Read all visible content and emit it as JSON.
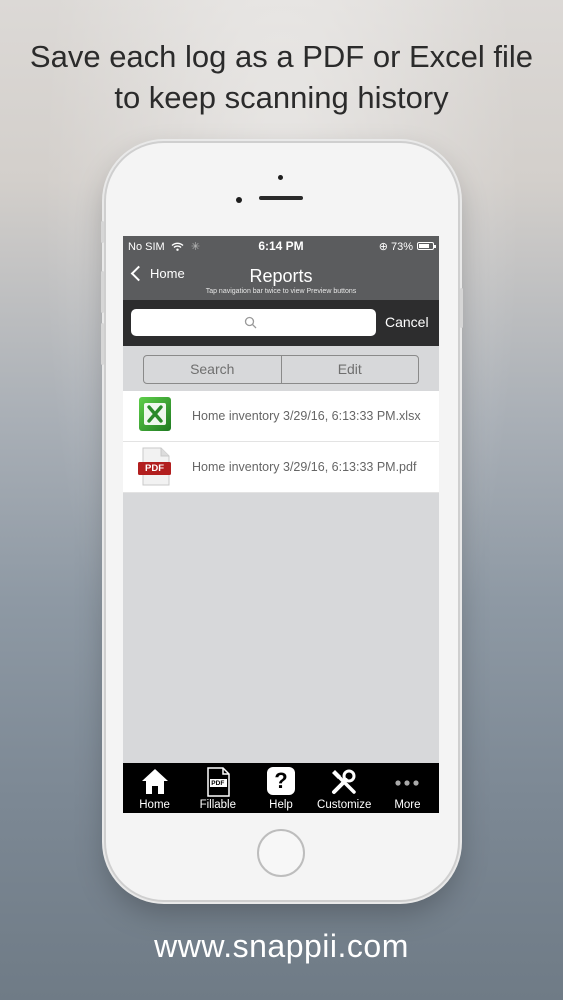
{
  "headline": {
    "line1": "Save each log as a PDF or Excel file",
    "line2": "to keep scanning history"
  },
  "footer_url": "www.snappii.com",
  "status_bar": {
    "carrier": "No SIM",
    "time": "6:14 PM",
    "battery": "73%"
  },
  "navbar": {
    "back_label": "Home",
    "title": "Reports",
    "subtitle": "Tap navigation bar twice to view Preview buttons"
  },
  "search": {
    "placeholder": "",
    "cancel_label": "Cancel"
  },
  "segment": {
    "search_label": "Search",
    "edit_label": "Edit"
  },
  "files": [
    {
      "name": "Home inventory 3/29/16, 6:13:33 PM.xlsx",
      "icon": "excel-file-icon"
    },
    {
      "name": "Home inventory 3/29/16, 6:13:33 PM.pdf",
      "icon": "pdf-file-icon",
      "icon_text": "PDF"
    }
  ],
  "tabbar": {
    "items": [
      {
        "label": "Home",
        "icon": "home-icon"
      },
      {
        "label": "Fillable",
        "icon": "fillable-pdf-icon",
        "icon_text": "PDF"
      },
      {
        "label": "Help",
        "icon": "help-icon",
        "icon_text": "?"
      },
      {
        "label": "Customize",
        "icon": "tools-icon"
      },
      {
        "label": "More",
        "icon": "more-icon"
      }
    ]
  },
  "colors": {
    "navbar": "#5b5c5e",
    "searchbar": "#2d2d2e",
    "tabbar": "#000000",
    "excel_green": "#2f8f2f",
    "pdf_red": "#b21f1f"
  }
}
